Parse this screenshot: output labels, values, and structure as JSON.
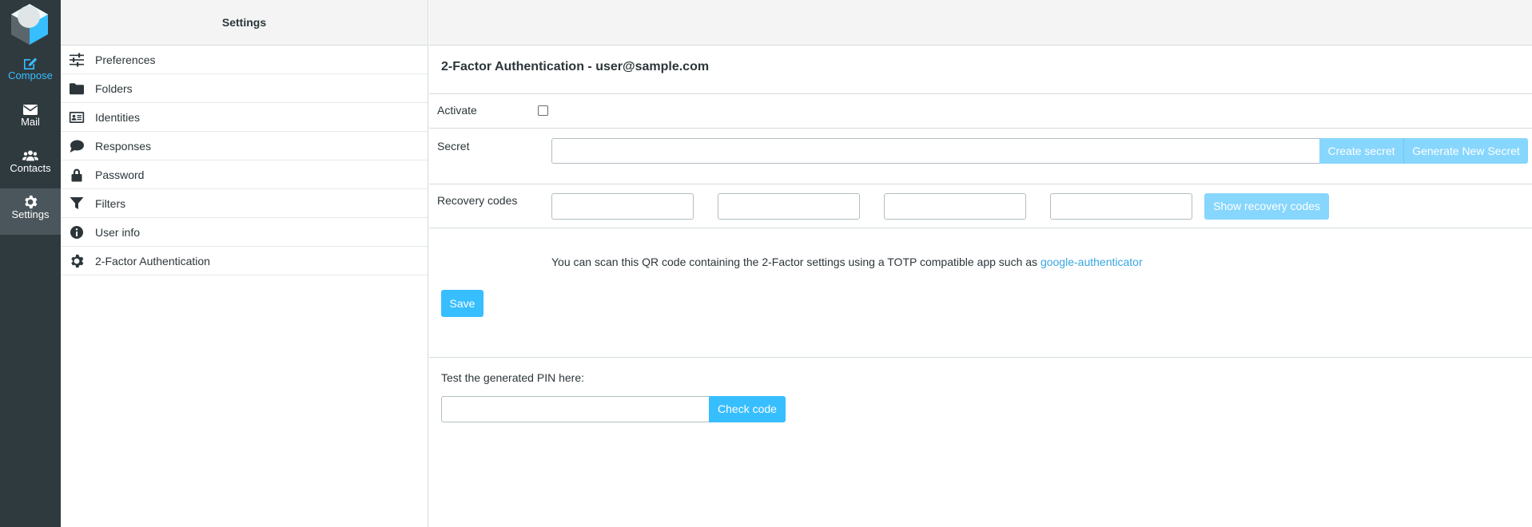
{
  "rail": {
    "items": [
      {
        "label": "Compose",
        "icon": "compose-icon"
      },
      {
        "label": "Mail",
        "icon": "mail-icon"
      },
      {
        "label": "Contacts",
        "icon": "contacts-icon"
      },
      {
        "label": "Settings",
        "icon": "gear-icon"
      }
    ],
    "active": "Settings",
    "accent_color": "#37beff"
  },
  "list": {
    "title": "Settings",
    "items": [
      {
        "label": "Preferences",
        "icon": "sliders-icon"
      },
      {
        "label": "Folders",
        "icon": "folder-icon"
      },
      {
        "label": "Identities",
        "icon": "id-card-icon"
      },
      {
        "label": "Responses",
        "icon": "comment-icon"
      },
      {
        "label": "Password",
        "icon": "lock-icon"
      },
      {
        "label": "Filters",
        "icon": "filter-icon"
      },
      {
        "label": "User info",
        "icon": "info-icon"
      },
      {
        "label": "2-Factor Authentication",
        "icon": "gear-icon"
      }
    ]
  },
  "content": {
    "title": "2-Factor Authentication - user@sample.com",
    "activate_label": "Activate",
    "activate_checked": false,
    "secret_label": "Secret",
    "secret_value": "",
    "create_secret_label": "Create secret",
    "generate_secret_label": "Generate New Secret",
    "recovery_label": "Recovery codes",
    "recovery_codes": [
      "",
      "",
      "",
      ""
    ],
    "show_recovery_label": "Show recovery codes",
    "qr_text": "You can scan this QR code containing the 2-Factor settings using a TOTP compatible app such as ",
    "qr_link_text": "google-authenticator",
    "save_label": "Save",
    "test_label": "Test the generated PIN here:",
    "pin_value": "",
    "check_code_label": "Check code"
  },
  "colors": {
    "button": "#37beff",
    "button_disabled": "#87d6fd",
    "rail_bg": "#2f3a3f",
    "link": "#37a6e0"
  }
}
